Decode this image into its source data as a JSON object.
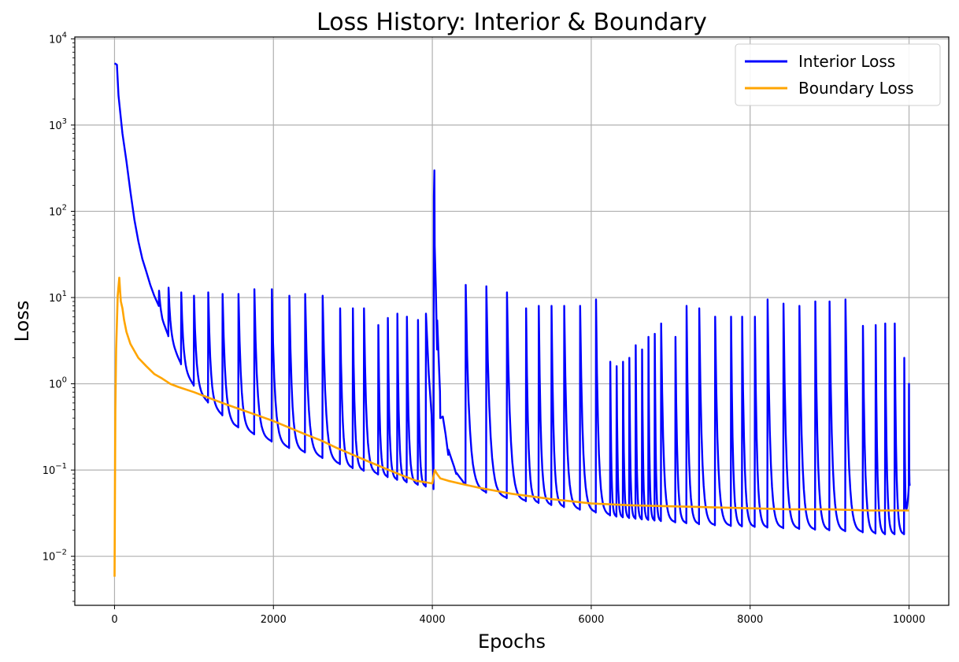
{
  "chart_data": {
    "type": "line",
    "title": "Loss History: Interior & Boundary",
    "xlabel": "Epochs",
    "ylabel": "Loss",
    "xlim": [
      -500,
      10500
    ],
    "ylim": [
      0.0027,
      10500
    ],
    "yscale": "log",
    "grid": true,
    "legend_position": "top-right",
    "x_ticks": [
      0,
      2000,
      4000,
      6000,
      8000,
      10000
    ],
    "x_tick_labels": [
      "0",
      "2000",
      "4000",
      "6000",
      "8000",
      "10000"
    ],
    "y_ticks": [
      0.01,
      0.1,
      1,
      10,
      100,
      1000,
      10000
    ],
    "y_tick_labels": [
      {
        "base": "10",
        "exp": "−2"
      },
      {
        "base": "10",
        "exp": "−1"
      },
      {
        "base": "10",
        "exp": "0"
      },
      {
        "base": "10",
        "exp": "1"
      },
      {
        "base": "10",
        "exp": "2"
      },
      {
        "base": "10",
        "exp": "3"
      },
      {
        "base": "10",
        "exp": "4"
      }
    ],
    "series": [
      {
        "name": "Interior Loss",
        "color": "#0000ff",
        "x": [
          0,
          30,
          50,
          80,
          100,
          150,
          200,
          250,
          300,
          350,
          400,
          450,
          500,
          560,
          600,
          700,
          800,
          900,
          1000,
          1100,
          1200,
          1300,
          1400,
          1500,
          1600,
          1800,
          2000,
          2200,
          2400,
          2600,
          2800,
          3000,
          3200,
          3400,
          3600,
          3800,
          4000,
          4020,
          4040,
          4060,
          4100,
          4200,
          4300,
          4400,
          4600,
          4800,
          5000,
          5300,
          5600,
          6000,
          6300,
          6600,
          7000,
          7500,
          8000,
          8500,
          9000,
          9400,
          9700,
          9950,
          10000
        ],
        "values": [
          5200,
          5000,
          2200,
          1200,
          800,
          380,
          170,
          80,
          45,
          28,
          20,
          14,
          10.5,
          8,
          5.5,
          3.2,
          2.0,
          1.3,
          0.95,
          0.72,
          0.58,
          0.48,
          0.4,
          0.33,
          0.3,
          0.25,
          0.21,
          0.18,
          0.16,
          0.14,
          0.12,
          0.105,
          0.095,
          0.085,
          0.075,
          0.068,
          0.062,
          150,
          20,
          2.5,
          0.4,
          0.15,
          0.09,
          0.07,
          0.058,
          0.05,
          0.046,
          0.042,
          0.038,
          0.033,
          0.029,
          0.027,
          0.025,
          0.023,
          0.022,
          0.021,
          0.02,
          0.019,
          0.018,
          0.018,
          0.065
        ],
        "spikes": [
          {
            "x": 560,
            "peak": 12
          },
          {
            "x": 680,
            "peak": 13
          },
          {
            "x": 840,
            "peak": 11.5
          },
          {
            "x": 1000,
            "peak": 10.5
          },
          {
            "x": 1180,
            "peak": 11.5
          },
          {
            "x": 1360,
            "peak": 11
          },
          {
            "x": 1560,
            "peak": 11
          },
          {
            "x": 1760,
            "peak": 12.5
          },
          {
            "x": 1980,
            "peak": 12.5
          },
          {
            "x": 2200,
            "peak": 10.5
          },
          {
            "x": 2400,
            "peak": 11
          },
          {
            "x": 2620,
            "peak": 10.5
          },
          {
            "x": 2840,
            "peak": 7.5
          },
          {
            "x": 3000,
            "peak": 7.5
          },
          {
            "x": 3140,
            "peak": 7.5
          },
          {
            "x": 3320,
            "peak": 4.8
          },
          {
            "x": 3440,
            "peak": 5.8
          },
          {
            "x": 3560,
            "peak": 6.5
          },
          {
            "x": 3680,
            "peak": 6.0
          },
          {
            "x": 3820,
            "peak": 5.5
          },
          {
            "x": 3920,
            "peak": 6.5
          },
          {
            "x": 4420,
            "peak": 14
          },
          {
            "x": 4680,
            "peak": 13.5
          },
          {
            "x": 4940,
            "peak": 11.5
          },
          {
            "x": 5180,
            "peak": 7.5
          },
          {
            "x": 5340,
            "peak": 8.0
          },
          {
            "x": 5500,
            "peak": 8.0
          },
          {
            "x": 5660,
            "peak": 8.0
          },
          {
            "x": 5860,
            "peak": 8.0
          },
          {
            "x": 6060,
            "peak": 9.5
          },
          {
            "x": 6240,
            "peak": 1.8
          },
          {
            "x": 6320,
            "peak": 1.6
          },
          {
            "x": 6400,
            "peak": 1.8
          },
          {
            "x": 6480,
            "peak": 2.0
          },
          {
            "x": 6560,
            "peak": 2.8
          },
          {
            "x": 6640,
            "peak": 2.5
          },
          {
            "x": 6720,
            "peak": 3.5
          },
          {
            "x": 6800,
            "peak": 3.8
          },
          {
            "x": 6880,
            "peak": 5.0
          },
          {
            "x": 7060,
            "peak": 3.5
          },
          {
            "x": 7200,
            "peak": 8.0
          },
          {
            "x": 7360,
            "peak": 7.5
          },
          {
            "x": 7560,
            "peak": 6.0
          },
          {
            "x": 7760,
            "peak": 6.0
          },
          {
            "x": 7900,
            "peak": 6.0
          },
          {
            "x": 8060,
            "peak": 6.0
          },
          {
            "x": 8220,
            "peak": 9.5
          },
          {
            "x": 8420,
            "peak": 8.5
          },
          {
            "x": 8620,
            "peak": 8.0
          },
          {
            "x": 8820,
            "peak": 9.0
          },
          {
            "x": 9000,
            "peak": 9.0
          },
          {
            "x": 9200,
            "peak": 9.5
          },
          {
            "x": 9420,
            "peak": 4.7
          },
          {
            "x": 9580,
            "peak": 4.8
          },
          {
            "x": 9700,
            "peak": 5.0
          },
          {
            "x": 9820,
            "peak": 5.0
          },
          {
            "x": 9940,
            "peak": 2.0
          },
          {
            "x": 10000,
            "peak": 1.0
          }
        ]
      },
      {
        "name": "Boundary Loss",
        "color": "#ffa500",
        "x": [
          0,
          10,
          20,
          40,
          60,
          70,
          80,
          100,
          120,
          150,
          200,
          300,
          400,
          500,
          600,
          700,
          800,
          1000,
          1200,
          1400,
          1600,
          1800,
          2000,
          2200,
          2400,
          2600,
          2800,
          3000,
          3200,
          3400,
          3600,
          3800,
          4000,
          4030,
          4060,
          4100,
          4200,
          4400,
          4600,
          5000,
          5500,
          6000,
          6500,
          7000,
          7500,
          8000,
          8500,
          9000,
          9500,
          10000
        ],
        "values": [
          0.0058,
          0.5,
          2.5,
          10.5,
          17.0,
          12.0,
          9.0,
          7.5,
          5.5,
          4.0,
          2.9,
          2.0,
          1.6,
          1.3,
          1.15,
          1.0,
          0.92,
          0.8,
          0.68,
          0.58,
          0.5,
          0.43,
          0.37,
          0.31,
          0.26,
          0.22,
          0.18,
          0.15,
          0.125,
          0.105,
          0.088,
          0.075,
          0.07,
          0.1,
          0.09,
          0.08,
          0.075,
          0.068,
          0.062,
          0.053,
          0.046,
          0.041,
          0.039,
          0.038,
          0.037,
          0.036,
          0.035,
          0.035,
          0.034,
          0.034
        ]
      }
    ]
  }
}
